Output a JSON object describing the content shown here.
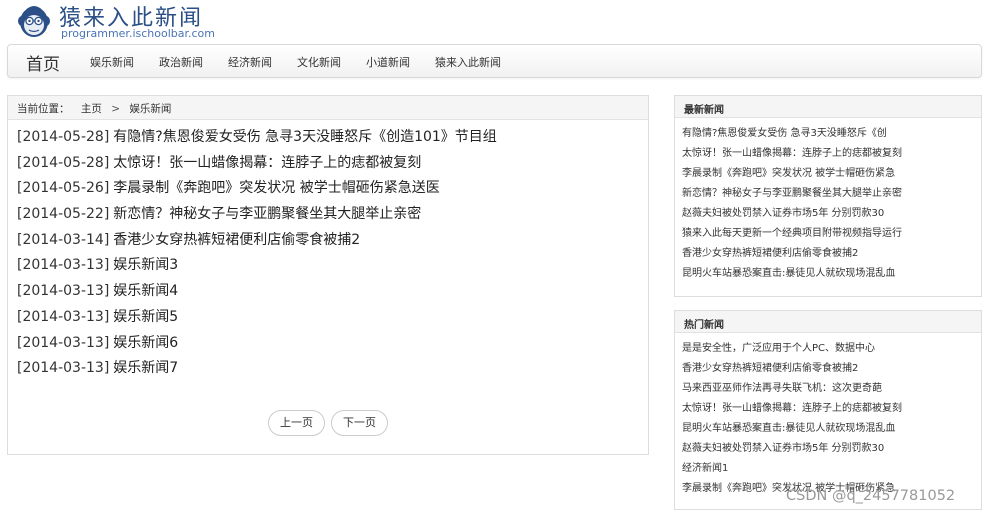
{
  "site": {
    "title": "猿来入此新闻",
    "subtitle": "programmer.ischoolbar.com"
  },
  "nav": {
    "brand": "首页",
    "links": [
      "娱乐新闻",
      "政治新闻",
      "经济新闻",
      "文化新闻",
      "小道新闻",
      "猿来入此新闻"
    ]
  },
  "breadcrumb": {
    "label": "当前位置：",
    "home": "主页",
    "separator": ">",
    "current": "娱乐新闻"
  },
  "news": [
    {
      "date": "[2014-05-28]",
      "title": "有隐情?焦恩俊爱女受伤 急寻3天没睡怒斥《创造101》节目组"
    },
    {
      "date": "[2014-05-28]",
      "title": "太惊讶！张一山蜡像揭幕：连脖子上的痣都被复刻"
    },
    {
      "date": "[2014-05-26]",
      "title": "李晨录制《奔跑吧》突发状况 被学士帽砸伤紧急送医"
    },
    {
      "date": "[2014-05-22]",
      "title": "新恋情？神秘女子与李亚鹏聚餐坐其大腿举止亲密"
    },
    {
      "date": "[2014-03-14]",
      "title": "香港少女穿热裤短裙便利店偷零食被捕2"
    },
    {
      "date": "[2014-03-13]",
      "title": "娱乐新闻3"
    },
    {
      "date": "[2014-03-13]",
      "title": "娱乐新闻4"
    },
    {
      "date": "[2014-03-13]",
      "title": "娱乐新闻5"
    },
    {
      "date": "[2014-03-13]",
      "title": "娱乐新闻6"
    },
    {
      "date": "[2014-03-13]",
      "title": "娱乐新闻7"
    }
  ],
  "pager": {
    "prev": "上一页",
    "next": "下一页"
  },
  "latest": {
    "heading": "最新新闻",
    "items": [
      "有隐情?焦恩俊爱女受伤 急寻3天没睡怒斥《创",
      "太惊讶！张一山蜡像揭幕：连脖子上的痣都被复刻",
      "李晨录制《奔跑吧》突发状况 被学士帽砸伤紧急",
      "新恋情？神秘女子与李亚鹏聚餐坐其大腿举止亲密",
      "赵薇夫妇被处罚禁入证券市场5年 分别罚款30",
      "猿来入此每天更新一个经典项目附带视频指导运行",
      "香港少女穿热裤短裙便利店偷零食被捕2",
      "昆明火车站暴恐案直击:暴徒见人就砍现场混乱血"
    ]
  },
  "hot": {
    "heading": "热门新闻",
    "items": [
      "是是安全性，广泛应用于个人PC、数据中心",
      "香港少女穿热裤短裙便利店偷零食被捕2",
      "马来西亚巫师作法再寻失联飞机：这次更奇葩",
      "太惊讶！张一山蜡像揭幕：连脖子上的痣都被复刻",
      "昆明火车站暴恐案直击:暴徒见人就砍现场混乱血",
      "赵薇夫妇被处罚禁入证券市场5年 分别罚款30",
      "经济新闻1",
      "李晨录制《奔跑吧》突发状况 被学士帽砸伤紧急"
    ]
  },
  "watermark": "CSDN @q_2457781052"
}
